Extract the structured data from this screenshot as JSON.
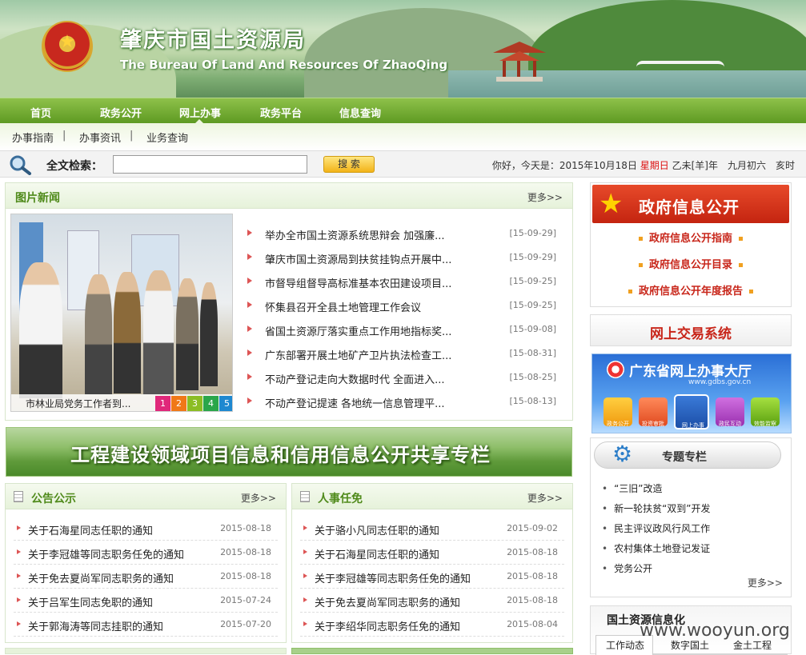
{
  "header": {
    "title": "肇庆市国土资源局",
    "subtitle": "The Bureau Of Land And Resources Of ZhaoQing"
  },
  "nav": {
    "items": [
      "首页",
      "政务公开",
      "网上办事",
      "政务平台",
      "信息查询"
    ],
    "active": "网上办事"
  },
  "subnav": {
    "items": [
      "办事指南",
      "办事资讯",
      "业务查询"
    ],
    "separator": "|"
  },
  "search": {
    "label": "全文检索：",
    "value": "",
    "button": "搜 索"
  },
  "date": {
    "prefix": "你好，今天是：2015年10月18日",
    "weekday": "星期日",
    "lunar": "乙未[羊]年　九月初六　亥时"
  },
  "photo_news": {
    "title": "图片新闻",
    "more": "更多>>",
    "caption": "市林业局党务工作者到...",
    "pages": [
      "1",
      "2",
      "3",
      "4",
      "5"
    ],
    "items": [
      {
        "title": "举办全市国土资源系统思辩会 加强廉...",
        "date": "[15-09-29]"
      },
      {
        "title": "肇庆市国土资源局到扶贫挂钩点开展中...",
        "date": "[15-09-29]"
      },
      {
        "title": "市督导组督导高标准基本农田建设项目...",
        "date": "[15-09-25]"
      },
      {
        "title": "怀集县召开全县土地管理工作会议",
        "date": "[15-09-25]"
      },
      {
        "title": "省国土资源厅落实重点工作用地指标奖...",
        "date": "[15-09-08]"
      },
      {
        "title": "广东部署开展土地矿产卫片执法检查工...",
        "date": "[15-08-31]"
      },
      {
        "title": "不动产登记走向大数据时代 全面进入...",
        "date": "[15-08-25]"
      },
      {
        "title": "不动产登记提速 各地统一信息管理平...",
        "date": "[15-08-13]"
      }
    ]
  },
  "project_banner": {
    "text": "工程建设领域项目信息和信用信息公开共享专栏"
  },
  "announcements": {
    "title": "公告公示",
    "more": "更多>>",
    "items": [
      {
        "title": "关于石海星同志任职的通知",
        "date": "2015-08-18"
      },
      {
        "title": "关于李冠雄等同志职务任免的通知",
        "date": "2015-08-18"
      },
      {
        "title": "关于免去夏尚军同志职务的通知",
        "date": "2015-08-18"
      },
      {
        "title": "关于吕军生同志免职的通知",
        "date": "2015-07-24"
      },
      {
        "title": "关于郭海涛等同志挂职的通知",
        "date": "2015-07-20"
      }
    ]
  },
  "personnel": {
    "title": "人事任免",
    "more": "更多>>",
    "items": [
      {
        "title": "关于骆小凡同志任职的通知",
        "date": "2015-09-02"
      },
      {
        "title": "关于石海星同志任职的通知",
        "date": "2015-08-18"
      },
      {
        "title": "关于李冠雄等同志职务任免的通知",
        "date": "2015-08-18"
      },
      {
        "title": "关于免去夏尚军同志职务的通知",
        "date": "2015-08-18"
      },
      {
        "title": "关于李绍华同志职务任免的通知",
        "date": "2015-08-04"
      }
    ]
  },
  "gov_info": {
    "title": "政府信息公开",
    "links": [
      "政府信息公开指南",
      "政府信息公开目录",
      "政府信息公开年度报告"
    ]
  },
  "online_trade": {
    "title": "网上交易系统"
  },
  "gd_hall": {
    "title": "广东省网上办事大厅",
    "url": "www.gdbs.gov.cn",
    "buttons": [
      "政务公开",
      "投资审批",
      "网上办事",
      "政民互动",
      "效能监察"
    ]
  },
  "topics": {
    "title": "专题专栏",
    "items": [
      "“三旧”改造",
      "新一轮扶贫“双到”开发",
      "民主评议政风行风工作",
      "农村集体土地登记发证",
      "党务公开"
    ],
    "more": "更多>>"
  },
  "info_build": {
    "title": "国土资源信息化",
    "tabs": [
      "工作动态",
      "数字国土",
      "金土工程"
    ]
  },
  "watermark": "www.wooyun.org"
}
